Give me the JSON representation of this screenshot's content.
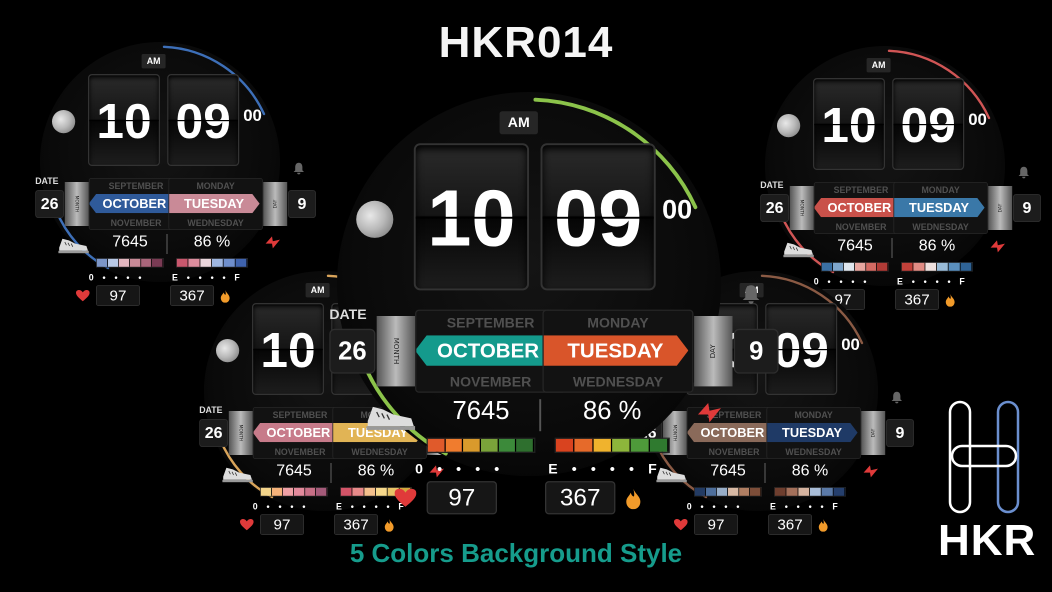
{
  "title": "HKR014",
  "subtitle": "5 Colors Background Style",
  "brand": {
    "text": "HKR"
  },
  "watch": {
    "ampm": "AM",
    "hour": "10",
    "minute": "09",
    "second": "00",
    "date_label": "DATE",
    "date": "26",
    "month_tag": "MONTH",
    "day_tag": "DAY",
    "month_prev": "SEPTEMBER",
    "month": "OCTOBER",
    "month_next": "NOVEMBER",
    "weekday_prev": "MONDAY",
    "weekday": "TUESDAY",
    "weekday_next": "WEDNESDAY",
    "day_number": "9",
    "steps": "7645",
    "battery": "86 %",
    "steps_scale": "0 • • • •",
    "battery_scale": "E • • • • F",
    "heart_rate": "97",
    "calories": "367",
    "icons": [
      "moon-icon",
      "bell-icon",
      "shoe-icon",
      "bolt-icon",
      "heart-icon",
      "flame-icon"
    ]
  },
  "variants": [
    {
      "name": "teal-orange",
      "month_color": "#149a8c",
      "weekday_color": "#d9552a",
      "arc_color": "#8bc34a",
      "bar_left": [
        "#e05a2b",
        "#f07c2e",
        "#d99a2c",
        "#7aa33a",
        "#3c8a3a",
        "#2e6f2e"
      ],
      "bar_right": [
        "#d9431f",
        "#e66a2a",
        "#f0b32d",
        "#8db63b",
        "#4e9a3a",
        "#2f7a2f"
      ]
    },
    {
      "name": "blue-pink",
      "month_color": "#2f5a9a",
      "weekday_color": "#c98a97",
      "arc_color": "#3d6fb8",
      "bar_left": [
        "#7c96c8",
        "#b9c9e6",
        "#e3b7c0",
        "#c98a97",
        "#a9657a",
        "#7a3b54"
      ],
      "bar_right": [
        "#c9576d",
        "#dd8d9e",
        "#ebd6dc",
        "#9fb6e0",
        "#6f8fcd",
        "#3f63ae"
      ]
    },
    {
      "name": "red-blue",
      "month_color": "#c9514a",
      "weekday_color": "#3a78a8",
      "arc_color": "#d05555",
      "bar_left": [
        "#3a6fa3",
        "#7ea6cc",
        "#dfe7ef",
        "#e8a7a1",
        "#d46a63",
        "#b23b36"
      ],
      "bar_right": [
        "#c2413a",
        "#e18c84",
        "#eee1df",
        "#98bbd8",
        "#5a8fbe",
        "#2f6396"
      ]
    },
    {
      "name": "pink-yellow",
      "month_color": "#c77b8a",
      "weekday_color": "#e1b455",
      "arc_color": "#d9a45a",
      "bar_left": [
        "#f3d48a",
        "#f6b37a",
        "#f0a1a6",
        "#e38a9c",
        "#c76f86",
        "#a45a79"
      ],
      "bar_right": [
        "#d35468",
        "#e88a8a",
        "#f4c08c",
        "#f7d98c",
        "#e8c367",
        "#d2a83e"
      ]
    },
    {
      "name": "brown-navy",
      "month_color": "#8a6a5a",
      "weekday_color": "#1f3a66",
      "arc_color": "#8a5a44",
      "bar_left": [
        "#233b63",
        "#4e6f9c",
        "#98aec8",
        "#d8b9a4",
        "#b07e62",
        "#7d4e39"
      ],
      "bar_right": [
        "#6e3e2e",
        "#a4705a",
        "#d6b4a0",
        "#a9bdd8",
        "#5b7aa8",
        "#253f6d"
      ]
    }
  ]
}
